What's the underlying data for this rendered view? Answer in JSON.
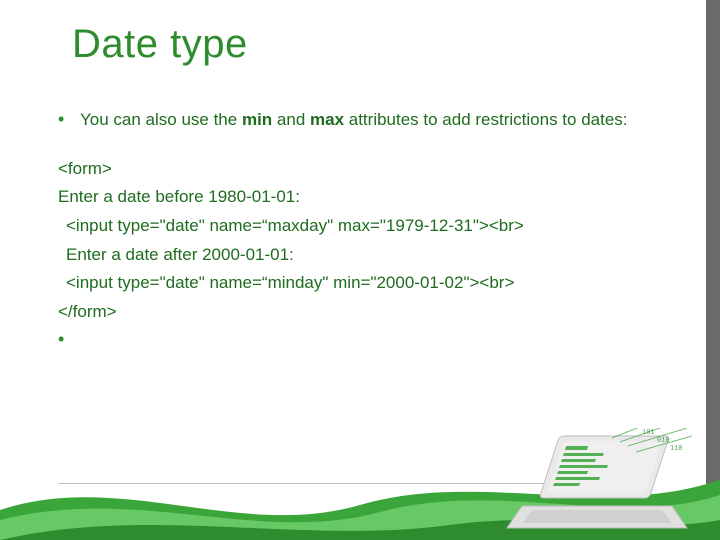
{
  "title": "Date type",
  "bullet1_pre": "You can also use the ",
  "bullet1_min": "min",
  "bullet1_mid": " and ",
  "bullet1_max": "max",
  "bullet1_post": " attributes to add restrictions to dates:",
  "code": {
    "form_open": "<form>",
    "label1": "Enter a date before 1980-01-01:",
    "input1": "<input type=\"date\" name=“maxday\" max=\"1979-12-31\"><br>",
    "label2": "Enter a date after 2000-01-01:",
    "input2": "<input type=\"date\" name=“minday\" min=\"2000-01-02\"><br>",
    "form_close": "</form>"
  },
  "bullet_char": "•"
}
